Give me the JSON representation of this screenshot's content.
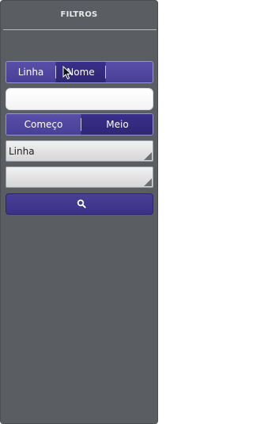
{
  "panel": {
    "title": "FILTROS"
  },
  "field_toggle": {
    "options": [
      "Linha",
      "Nome"
    ],
    "selected": "Nome"
  },
  "search_text": {
    "value": "",
    "placeholder": ""
  },
  "match_toggle": {
    "options": [
      "Começo",
      "Meio"
    ],
    "selected": "Meio"
  },
  "select_1": {
    "value": "Linha"
  },
  "select_2": {
    "value": ""
  },
  "search_button": {
    "icon": "search-icon"
  },
  "colors": {
    "panel_bg": "#5a5e62",
    "accent": "#3b3186",
    "accent_border": "#8f98d6"
  }
}
